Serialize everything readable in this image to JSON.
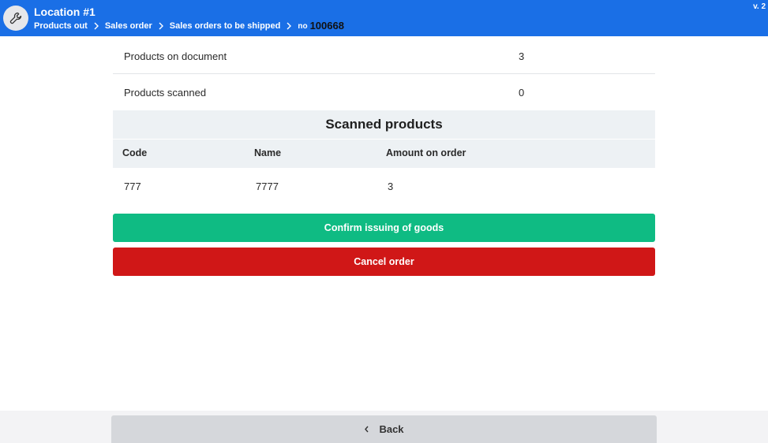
{
  "header": {
    "title": "Location #1",
    "version": "v. 2",
    "icon": "wrench-icon",
    "breadcrumb": [
      "Products out",
      "Sales order",
      "Sales orders to be shipped"
    ],
    "doc_prefix": "no",
    "doc_number": "100668"
  },
  "summary": {
    "products_on_document_label": "Products on document",
    "products_on_document_value": "3",
    "products_scanned_label": "Products scanned",
    "products_scanned_value": "0"
  },
  "scanned": {
    "title": "Scanned products",
    "columns": [
      "Code",
      "Name",
      "Amount on order"
    ],
    "rows": [
      {
        "code": "777",
        "name": "7777",
        "amount": "3"
      }
    ]
  },
  "actions": {
    "confirm_label": "Confirm issuing of goods",
    "cancel_label": "Cancel order",
    "confirm_color": "#0fbb83",
    "cancel_color": "#d01717"
  },
  "footer": {
    "back_label": "Back"
  },
  "colors": {
    "header_bg": "#1a6fe6"
  }
}
